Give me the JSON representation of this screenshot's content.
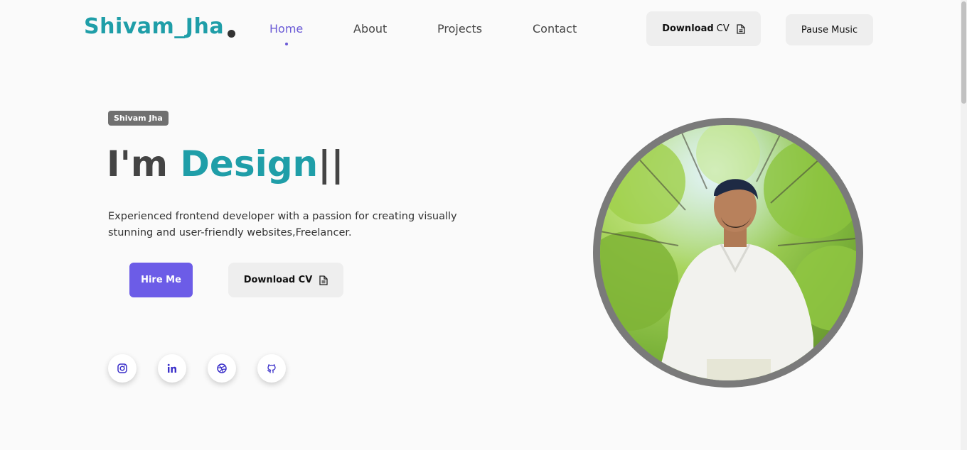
{
  "brand": {
    "name": "Shivam_Jha"
  },
  "nav": {
    "items": [
      "Home",
      "About",
      "Projects",
      "Contact"
    ],
    "active": "Home"
  },
  "header_actions": {
    "download_bold": "Download",
    "download_rest": "CV",
    "music_label": "Pause Music"
  },
  "hero": {
    "tag": "Shivam Jha",
    "headline_prefix": "I'm ",
    "headline_accent": "Design",
    "headline_cursor": "||",
    "description": "Experienced frontend developer with a passion for creating visually stunning and user-friendly websites,Freelancer.",
    "hire_label": "Hire Me",
    "download_label": "Download CV"
  },
  "social": [
    {
      "icon": "instagram-icon"
    },
    {
      "icon": "linkedin-icon"
    },
    {
      "icon": "dribbble-icon"
    },
    {
      "icon": "github-icon"
    }
  ],
  "colors": {
    "brand_teal": "#1f9ea8",
    "accent_purple": "#6c5ce7",
    "nav_active": "#6a5ad6",
    "button_grey": "#eeeeee",
    "portrait_border": "#7a7a7a"
  }
}
